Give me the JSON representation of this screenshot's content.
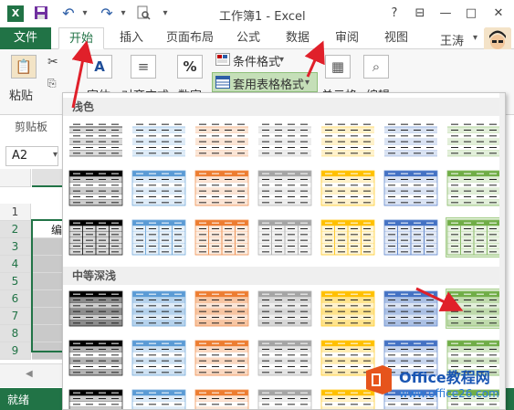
{
  "app": {
    "title": "工作簿1 - Excel",
    "user": "王涛"
  },
  "titlebar": {
    "help": "?",
    "minimize": "—",
    "restore": "□",
    "close": "✕",
    "restore_ribbon": "⊟"
  },
  "tabs": [
    {
      "label": "文件"
    },
    {
      "label": "开始"
    },
    {
      "label": "插入"
    },
    {
      "label": "页面布局"
    },
    {
      "label": "公式"
    },
    {
      "label": "数据"
    },
    {
      "label": "审阅"
    },
    {
      "label": "视图"
    }
  ],
  "ribbon": {
    "paste": "粘贴",
    "font": "字体",
    "align": "对齐方式",
    "number": "数字",
    "cond_format": "条件格式",
    "table_format": "套用表格格式",
    "cells": "单元格",
    "edit": "编辑",
    "clipboard_group": "剪贴板",
    "dropdown": "▾",
    "percent": "%",
    "font_glyph": "A"
  },
  "namebox": "A2",
  "sheet": {
    "rows": [
      "1",
      "2",
      "3",
      "4",
      "5",
      "6",
      "7",
      "8",
      "9"
    ],
    "cell_a2": "编"
  },
  "status": {
    "ready": "就绪"
  },
  "gallery": {
    "light_label": "浅色",
    "medium_label": "中等深浅"
  },
  "colors": {
    "excel_green": "#217346",
    "styles": [
      "#000000",
      "#5b9bd5",
      "#ed7d31",
      "#a5a5a5",
      "#ffc000",
      "#4472c4",
      "#70ad47"
    ]
  },
  "watermark": {
    "title": "Office教程网",
    "sub": "www.office26.com"
  }
}
